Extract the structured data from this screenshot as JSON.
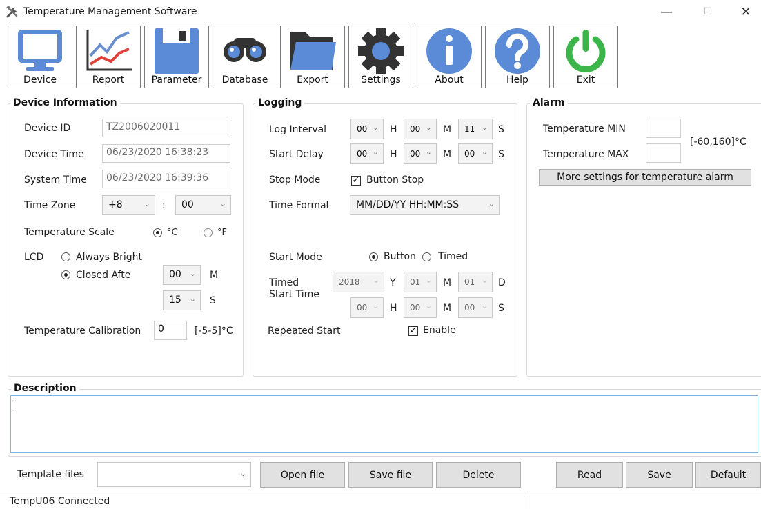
{
  "window": {
    "title": "Temperature Management Software",
    "minimize": "—",
    "maximize": "☐",
    "close": "✕"
  },
  "toolbar": [
    {
      "label": "Device",
      "icon": "monitor-icon"
    },
    {
      "label": "Report",
      "icon": "line-chart-icon"
    },
    {
      "label": "Parameter",
      "icon": "floppy-disk-icon"
    },
    {
      "label": "Database",
      "icon": "binoculars-icon"
    },
    {
      "label": "Export",
      "icon": "folder-icon"
    },
    {
      "label": "Settings",
      "icon": "gear-icon"
    },
    {
      "label": "About",
      "icon": "info-icon"
    },
    {
      "label": "Help",
      "icon": "help-icon"
    },
    {
      "label": "Exit",
      "icon": "power-icon"
    }
  ],
  "device": {
    "title": "Device Information",
    "id_label": "Device ID",
    "id_value": "TZ2006020011",
    "time_label": "Device Time",
    "time_value": "06/23/2020 16:38:23",
    "system_label": "System Time",
    "system_value": "06/23/2020 16:39:36",
    "tz_label": "Time Zone",
    "tz_hours": "+8",
    "tz_sep": ":",
    "tz_minutes": "00",
    "scale_label": "Temperature Scale",
    "scale_c": "°C",
    "scale_f": "°F",
    "lcd_label": "LCD",
    "always_bright": "Always Bright",
    "closed_after": "Closed Afte",
    "closed_minutes": "00",
    "minutes_unit": "M",
    "closed_seconds": "15",
    "seconds_unit": "S",
    "calib_label": "Temperature Calibration",
    "calib_value": "0",
    "calib_range": "[-5-5]°C"
  },
  "logging": {
    "title": "Logging",
    "interval_label": "Log Interval",
    "interval": {
      "h": "00",
      "m": "00",
      "s": "11"
    },
    "delay_label": "Start Delay",
    "delay": {
      "h": "00",
      "m": "00",
      "s": "00"
    },
    "unit_h": "H",
    "unit_m": "M",
    "unit_s": "S",
    "stop_label": "Stop Mode",
    "stop_option": "Button Stop",
    "format_label": "Time Format",
    "format_value": "MM/DD/YY HH:MM:SS",
    "start_label": "Start Mode",
    "start_button": "Button",
    "start_timed": "Timed",
    "timed_label_1": "Timed",
    "timed_label_2": "Start Time",
    "timed": {
      "year": "2018",
      "month": "01",
      "day": "01",
      "h": "00",
      "m": "00",
      "s": "00"
    },
    "unit_y": "Y",
    "unit_d": "D",
    "repeat_label": "Repeated Start",
    "repeat_option": "Enable"
  },
  "alarm": {
    "title": "Alarm",
    "min_label": "Temperature MIN",
    "max_label": "Temperature MAX",
    "range": "[-60,160]°C",
    "more_button": "More settings for temperature alarm"
  },
  "description": {
    "title": "Description",
    "value": ""
  },
  "bottom": {
    "template_label": "Template files",
    "template_value": "",
    "open": "Open file",
    "save_file": "Save file",
    "delete": "Delete",
    "read": "Read",
    "save": "Save",
    "default": "Default"
  },
  "status": {
    "text": "TempU06 Connected"
  }
}
